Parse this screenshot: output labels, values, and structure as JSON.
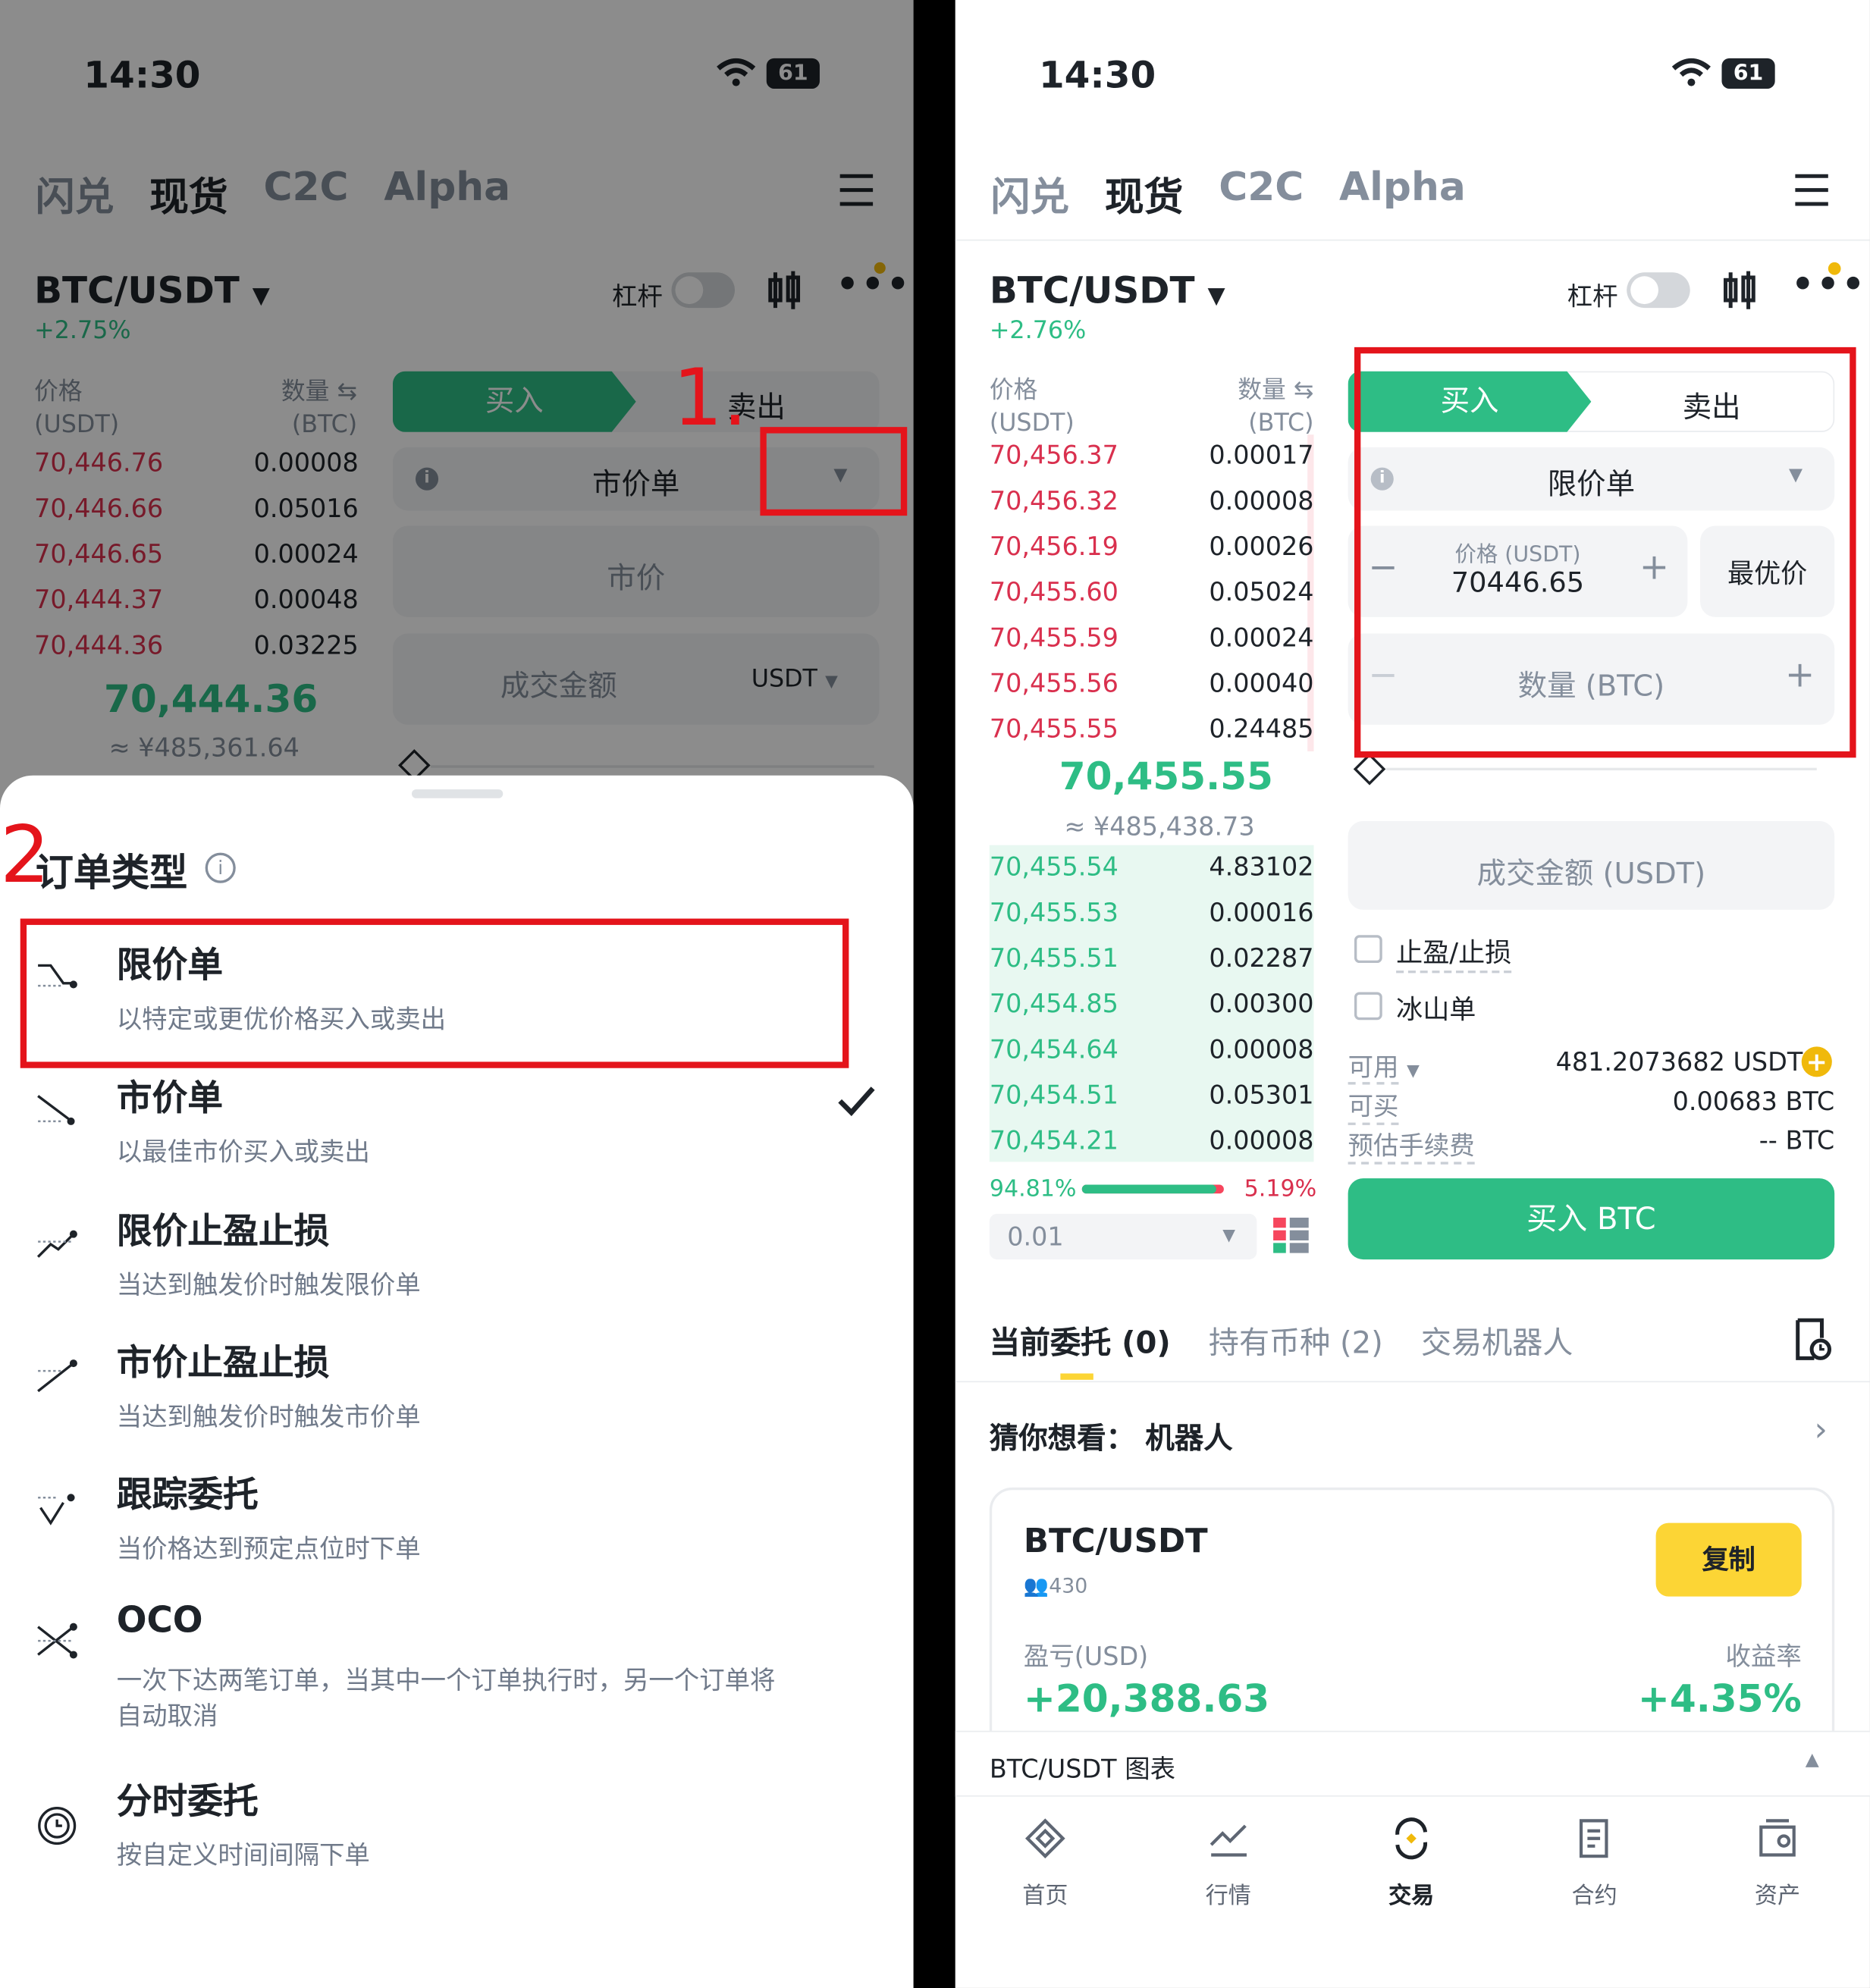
{
  "colors": {
    "brand_green": "#2ebd85",
    "ask_red": "#d9304e",
    "accent_yellow": "#fcd535",
    "annotation_red": "#e4141b"
  },
  "left": {
    "status": {
      "time": "14:30",
      "battery": "61"
    },
    "nav_tabs": [
      "闪兑",
      "现货",
      "C2C",
      "Alpha"
    ],
    "pair": "BTC/USDT",
    "change": "+2.75%",
    "leverage_label": "杠杆",
    "orderbook": {
      "price_header": "价格",
      "price_unit": "(USDT)",
      "qty_header": "数量",
      "qty_unit": "(BTC)",
      "asks": [
        [
          "70,446.76",
          "0.00008"
        ],
        [
          "70,446.66",
          "0.05016"
        ],
        [
          "70,446.65",
          "0.00024"
        ],
        [
          "70,444.37",
          "0.00048"
        ],
        [
          "70,444.36",
          "0.03225"
        ]
      ],
      "last_price": "70,444.36",
      "last_cny": "≈ ¥485,361.64"
    },
    "buy_label": "买入",
    "sell_label": "卖出",
    "order_type": "市价单",
    "market_placeholder": "市价",
    "amount_label": "成交金额",
    "amount_unit": "USDT",
    "annot1": "1.",
    "annot2": "2",
    "sheet": {
      "title": "订单类型",
      "options": [
        {
          "name": "限价单",
          "desc": "以特定或更优价格买入或卖出",
          "icon": "limit-order-icon"
        },
        {
          "name": "市价单",
          "desc": "以最佳市价买入或卖出",
          "icon": "market-order-icon",
          "selected": true
        },
        {
          "name": "限价止盈止损",
          "desc": "当达到触发价时触发限价单",
          "icon": "stop-limit-icon"
        },
        {
          "name": "市价止盈止损",
          "desc": "当达到触发价时触发市价单",
          "icon": "stop-market-icon"
        },
        {
          "name": "跟踪委托",
          "desc": "当价格达到预定点位时下单",
          "icon": "trailing-stop-icon"
        },
        {
          "name": "OCO",
          "desc": "一次下达两笔订单，当其中一个订单执行时，另一个订单将",
          "desc2": "自动取消",
          "icon": "oco-icon"
        },
        {
          "name": "分时委托",
          "desc": "按自定义时间间隔下单",
          "icon": "twap-clock-icon"
        }
      ]
    }
  },
  "right": {
    "status": {
      "time": "14:30",
      "battery": "61"
    },
    "nav_tabs": [
      "闪兑",
      "现货",
      "C2C",
      "Alpha"
    ],
    "pair": "BTC/USDT",
    "change": "+2.76%",
    "leverage_label": "杠杆",
    "orderbook": {
      "price_header": "价格",
      "price_unit": "(USDT)",
      "qty_header": "数量",
      "qty_unit": "(BTC)",
      "asks": [
        [
          "70,456.37",
          "0.00017"
        ],
        [
          "70,456.32",
          "0.00008"
        ],
        [
          "70,456.19",
          "0.00026"
        ],
        [
          "70,455.60",
          "0.05024"
        ],
        [
          "70,455.59",
          "0.00024"
        ],
        [
          "70,455.56",
          "0.00040"
        ],
        [
          "70,455.55",
          "0.24485"
        ]
      ],
      "last_price": "70,455.55",
      "last_cny": "≈ ¥485,438.73",
      "bids": [
        [
          "70,455.54",
          "4.83102"
        ],
        [
          "70,455.53",
          "0.00016"
        ],
        [
          "70,455.51",
          "0.02287"
        ],
        [
          "70,454.85",
          "0.00300"
        ],
        [
          "70,454.64",
          "0.00008"
        ],
        [
          "70,454.51",
          "0.05301"
        ],
        [
          "70,454.21",
          "0.00008"
        ]
      ],
      "bid_pct": "94.81%",
      "ask_pct": "5.19%",
      "bid_ratio": 0.9481,
      "tick": "0.01"
    },
    "buy_label": "买入",
    "sell_label": "卖出",
    "order_type": "限价单",
    "price_label": "价格 (USDT)",
    "price_value": "70446.65",
    "best_price": "最优价",
    "qty_label": "数量 (BTC)",
    "amount_label": "成交金额 (USDT)",
    "tp_sl": "止盈/止损",
    "iceberg": "冰山单",
    "avail_label": "可用",
    "avail_value": "481.2073682 USDT",
    "buyable_label": "可买",
    "buyable_value": "0.00683 BTC",
    "fee_label": "预估手续费",
    "fee_value": "-- BTC",
    "buy_button": "买入 BTC",
    "tabs": [
      "当前委托 (0)",
      "持有币种 (2)",
      "交易机器人"
    ],
    "suggest": "猜你想看：  机器人",
    "bot": {
      "pair": "BTC/USDT",
      "users": "430",
      "copy": "复制",
      "pnl_label": "盈亏(USD)",
      "pnl": "+20,388.63",
      "roi_label": "收益率",
      "roi": "+4.35%"
    },
    "chart_bar": "BTC/USDT 图表",
    "bottom_nav": [
      "首页",
      "行情",
      "交易",
      "合约",
      "资产"
    ]
  }
}
